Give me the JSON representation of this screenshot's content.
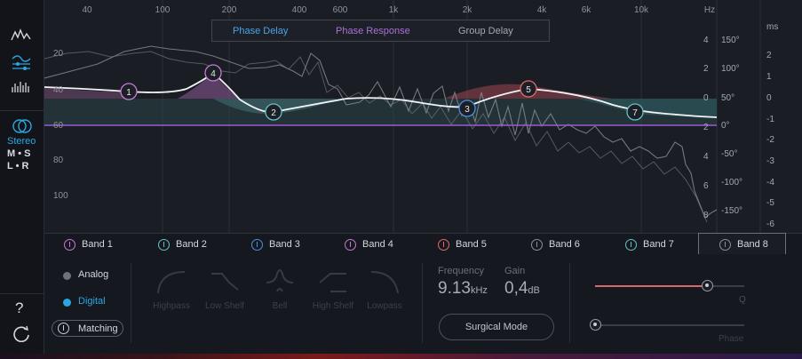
{
  "graph": {
    "freq_labels": [
      "40",
      "100",
      "200",
      "400",
      "600",
      "1k",
      "2k",
      "4k",
      "6k",
      "10k",
      "Hz"
    ],
    "db_labels": [
      "20",
      "40",
      "60",
      "80",
      "100"
    ],
    "gain_labels": [
      "4",
      "2",
      "0",
      "2",
      "4",
      "6",
      "8"
    ],
    "phase_labels": [
      "150°",
      "100°",
      "50°",
      "0°",
      "-50°",
      "-100°",
      "-150°"
    ],
    "ms_labels": [
      "ms",
      "2",
      "1",
      "0",
      "-1",
      "-2",
      "-3",
      "-4",
      "-5",
      "-6"
    ],
    "nodes": [
      "1",
      "2",
      "3",
      "4",
      "5",
      "7"
    ],
    "node_colors": {
      "purple": "#c77ad4",
      "teal": "#63c2c5",
      "blue": "#4d8fe0",
      "red": "#e06a6a"
    }
  },
  "view_tabs": {
    "phase_delay": "Phase Delay",
    "phase_response": "Phase Response",
    "group_delay": "Group Delay"
  },
  "sidebar": {
    "stereo": "Stereo",
    "ms": "M • S",
    "lr": "L • R",
    "help": "?"
  },
  "bands": [
    "Band 1",
    "Band 2",
    "Band 3",
    "Band 4",
    "Band 5",
    "Band 6",
    "Band 7",
    "Band 8"
  ],
  "mode": {
    "analog": "Analog",
    "digital": "Digital",
    "matching": "Matching"
  },
  "shapes": [
    "Highpass",
    "Low Shelf",
    "Bell",
    "High Shelf",
    "Lowpass"
  ],
  "params": {
    "frequency_label": "Frequency",
    "frequency_value": "9.13",
    "frequency_unit": "kHz",
    "gain_label": "Gain",
    "gain_value": "0,4",
    "gain_unit": "dB",
    "surgical": "Surgical Mode",
    "q_label": "Q",
    "q_level": 0.75,
    "phase_label": "Phase",
    "phase_level": 0.0
  },
  "colors": {
    "accent": "#29a8e0",
    "phase_line": "#9b59d6"
  }
}
